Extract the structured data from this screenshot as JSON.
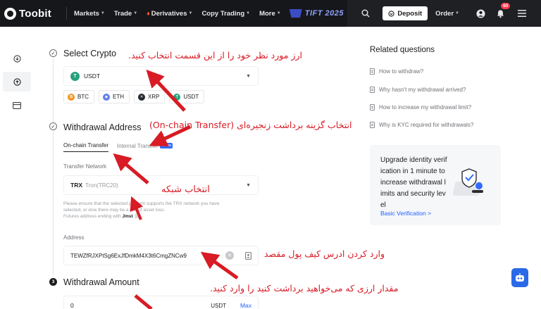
{
  "nav": {
    "logo_text": "Toobit",
    "links": [
      {
        "label": "Markets",
        "has_dropdown": true
      },
      {
        "label": "Trade",
        "has_dropdown": true
      },
      {
        "label": "Derivatives",
        "has_dropdown": true
      },
      {
        "label": "Copy Trading",
        "has_dropdown": true
      },
      {
        "label": "More",
        "has_dropdown": true
      }
    ],
    "promo_text": "TIFT 2025",
    "deposit_label": "Deposit",
    "order_label": "Order",
    "notification_count": "60"
  },
  "steps": {
    "select_crypto": {
      "title": "Select Crypto",
      "selected_coin": "USDT",
      "quick_coins": [
        "BTC",
        "ETH",
        "XRP",
        "USDT"
      ]
    },
    "withdrawal_address": {
      "title": "Withdrawal Address",
      "tabs": [
        {
          "label": "On-chain Transfer",
          "active": true
        },
        {
          "label": "Internal Transfer",
          "active": false,
          "tag": "0 Fee"
        }
      ],
      "network_label": "Transfer Network",
      "network_value": "TRX",
      "network_sub": "Tron(TRC20)",
      "hint_line1": "Please ensure that the selected platform supports the TRX network you have",
      "hint_line2": "selected, or else there may be a risk of asset loss.",
      "hint_line3_prefix": "Futures address ending with",
      "hint_line3_code": "Jmst",
      "address_label": "Address",
      "address_value": "TEWZfRJXPtSg6ExJfDmkM4X3t6CmgZNCw9"
    },
    "withdrawal_amount": {
      "step_number": "3",
      "title": "Withdrawal Amount",
      "amount_value": "0",
      "unit": "USDT",
      "max_label": "Max"
    }
  },
  "related": {
    "title": "Related questions",
    "items": [
      "How to withdraw?",
      "Why hasn't my withdrawal arrived?",
      "How to increase my withdrawal limit?",
      "Why is KYC required for withdrawals?"
    ]
  },
  "verify_card": {
    "text": "Upgrade identity verification in 1 minute to increase withdrawal limits and security level",
    "link": "Basic Verification >"
  },
  "annotations": {
    "select_coin": "ارز مورد نظر خود را از این قسمت انتخاب کنید.",
    "onchain": "انتخاب گزینه برداشت زنجیره‌ای (On-chain Transfer)",
    "network": "انتخاب شبکه",
    "address": "وارد کردن ادرس کیف پول مقصد",
    "amount": "مقدار ارزی که می‌خواهید برداشت کنید را وارد کنید."
  },
  "colors": {
    "nav_bg": "#16171b",
    "accent_red": "#d81b24",
    "link_blue": "#1f5eff",
    "tag_blue": "#2f6bff",
    "usdt_green": "#26a17b",
    "btc_orange": "#f7931a",
    "eth_blue": "#627eea"
  }
}
